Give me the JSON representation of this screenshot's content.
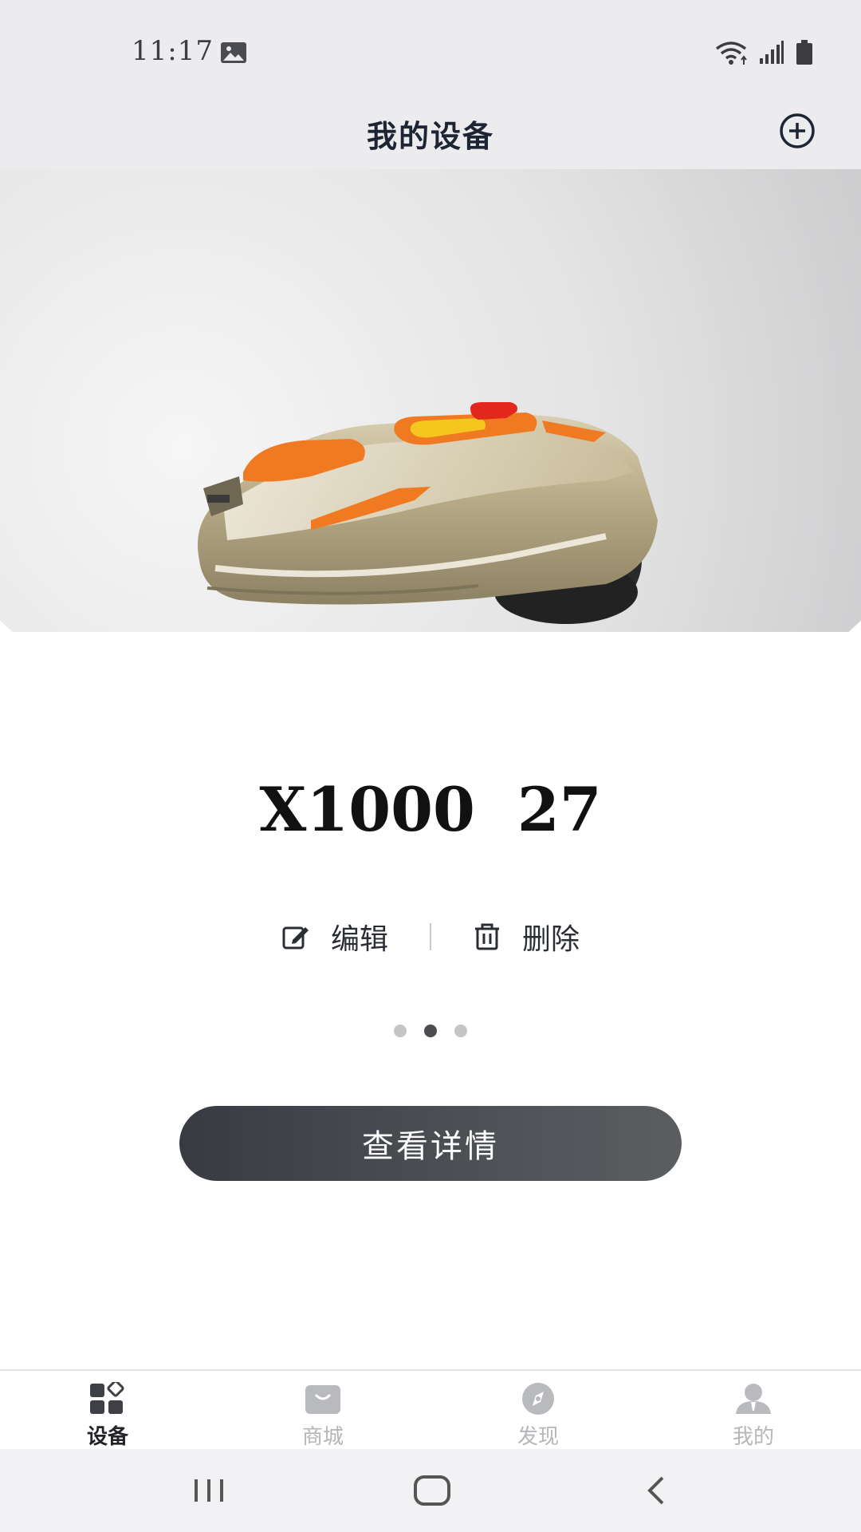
{
  "status_bar": {
    "time": "11:17",
    "icons": [
      "image-icon",
      "wifi-icon",
      "signal-icon",
      "battery-icon"
    ]
  },
  "header": {
    "title": "我的设备",
    "add_icon": "add-circle-icon"
  },
  "device": {
    "image": "lawn-mower-robot",
    "name": "X1000  27",
    "edit_label": "编辑",
    "delete_label": "删除",
    "carousel": {
      "count": 3,
      "active_index": 1
    }
  },
  "details_button": "查看详情",
  "tabs": [
    {
      "label": "设备",
      "icon": "device-grid-icon",
      "active": true
    },
    {
      "label": "商城",
      "icon": "shop-bag-icon",
      "active": false
    },
    {
      "label": "发现",
      "icon": "compass-icon",
      "active": false
    },
    {
      "label": "我的",
      "icon": "user-icon",
      "active": false
    }
  ],
  "system_nav": [
    "recent-apps-icon",
    "home-icon",
    "back-icon"
  ],
  "colors": {
    "accent_dark": "#3a3c42",
    "tab_inactive": "#b5b6ba",
    "mower_orange": "#f07a22"
  }
}
